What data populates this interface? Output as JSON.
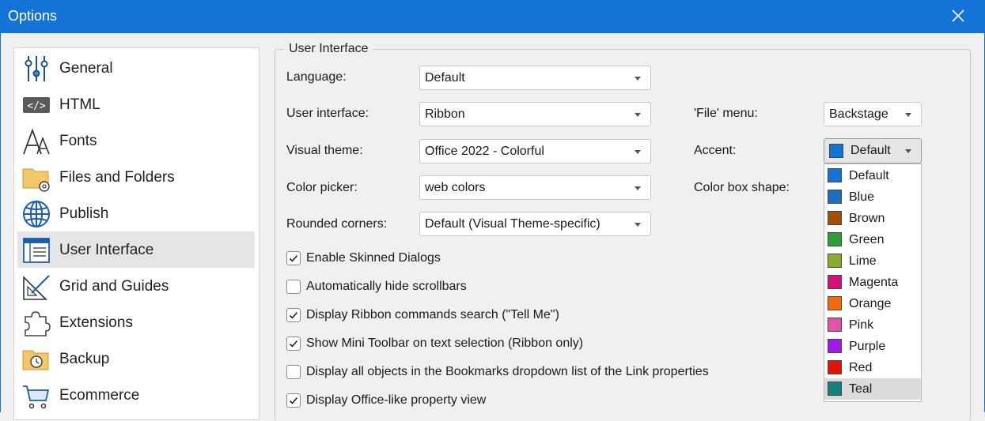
{
  "window": {
    "title": "Options"
  },
  "nav": {
    "items": [
      {
        "label": "General",
        "icon": "sliders-icon"
      },
      {
        "label": "HTML",
        "icon": "html-tag-icon"
      },
      {
        "label": "Fonts",
        "icon": "fonts-icon"
      },
      {
        "label": "Files and Folders",
        "icon": "folder-gear-icon"
      },
      {
        "label": "Publish",
        "icon": "globe-icon"
      },
      {
        "label": "User Interface",
        "icon": "window-layout-icon",
        "selected": true
      },
      {
        "label": "Grid and Guides",
        "icon": "grid-ruler-icon"
      },
      {
        "label": "Extensions",
        "icon": "puzzle-icon"
      },
      {
        "label": "Backup",
        "icon": "backup-folder-icon"
      },
      {
        "label": "Ecommerce",
        "icon": "cart-icon"
      }
    ]
  },
  "group": {
    "title": "User Interface"
  },
  "settings": {
    "language": {
      "label": "Language:",
      "value": "Default"
    },
    "user_interface": {
      "label": "User interface:",
      "value": "Ribbon"
    },
    "visual_theme": {
      "label": "Visual theme:",
      "value": "Office 2022 - Colorful"
    },
    "color_picker": {
      "label": "Color picker:",
      "value": "web colors"
    },
    "rounded_corners": {
      "label": "Rounded corners:",
      "value": "Default (Visual Theme-specific)"
    },
    "file_menu": {
      "label": "'File' menu:",
      "value": "Backstage"
    },
    "accent": {
      "label": "Accent:",
      "value": "Default",
      "color": "#1473d6"
    },
    "color_box_shape": {
      "label": "Color box shape:"
    }
  },
  "checkboxes": [
    {
      "label": "Enable Skinned Dialogs",
      "checked": true
    },
    {
      "label": "Automatically hide scrollbars",
      "checked": false
    },
    {
      "label": "Display Ribbon commands search (\"Tell Me\")",
      "checked": true
    },
    {
      "label": "Show Mini Toolbar on text selection (Ribbon only)",
      "checked": true
    },
    {
      "label": "Display all objects in the Bookmarks dropdown list of the Link properties",
      "checked": false
    },
    {
      "label": "Display Office-like property view",
      "checked": true
    }
  ],
  "accent_options": [
    {
      "label": "Default",
      "color": "#1473d6"
    },
    {
      "label": "Blue",
      "color": "#1a6fc2"
    },
    {
      "label": "Brown",
      "color": "#a24f0c"
    },
    {
      "label": "Green",
      "color": "#2e9e3a"
    },
    {
      "label": "Lime",
      "color": "#8bab2c"
    },
    {
      "label": "Magenta",
      "color": "#d5107a"
    },
    {
      "label": "Orange",
      "color": "#f46a0e"
    },
    {
      "label": "Pink",
      "color": "#e154a6"
    },
    {
      "label": "Purple",
      "color": "#a019f0"
    },
    {
      "label": "Red",
      "color": "#e1140a"
    },
    {
      "label": "Teal",
      "color": "#16807d",
      "selected": true
    }
  ]
}
